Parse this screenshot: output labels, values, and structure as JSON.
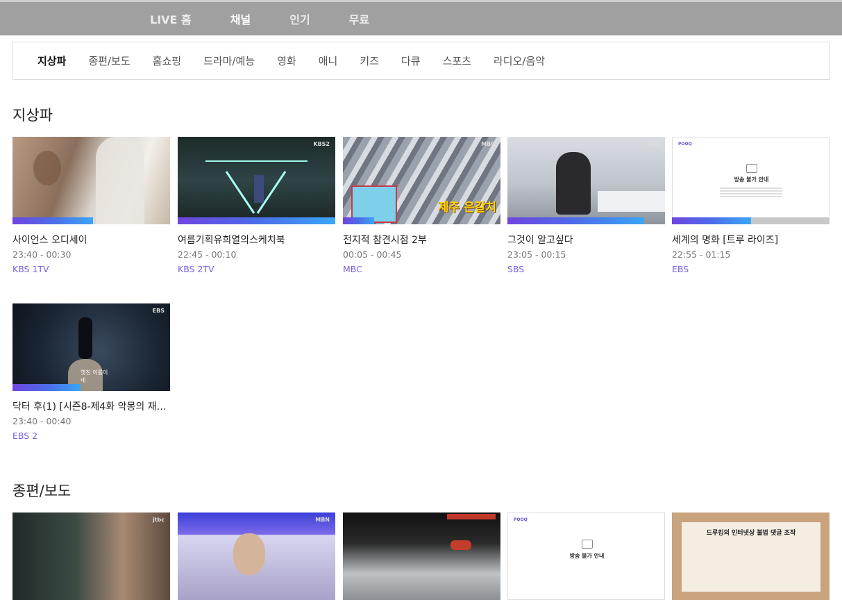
{
  "topnav": [
    {
      "label": "LIVE 홈",
      "active": false
    },
    {
      "label": "채널",
      "active": true
    },
    {
      "label": "인기",
      "active": false
    },
    {
      "label": "무료",
      "active": false
    }
  ],
  "categories": [
    {
      "label": "지상파",
      "active": true
    },
    {
      "label": "종편/보도",
      "active": false
    },
    {
      "label": "홈쇼핑",
      "active": false
    },
    {
      "label": "드라마/예능",
      "active": false
    },
    {
      "label": "영화",
      "active": false
    },
    {
      "label": "애니",
      "active": false
    },
    {
      "label": "키즈",
      "active": false
    },
    {
      "label": "다큐",
      "active": false
    },
    {
      "label": "스포츠",
      "active": false
    },
    {
      "label": "라디오/음악",
      "active": false
    }
  ],
  "sections": [
    {
      "title": "지상파",
      "cards": [
        {
          "title": "사이언스 오디세이",
          "time": "23:40 - 00:30",
          "channel": "KBS 1TV",
          "progress": 0.51,
          "badge": ""
        },
        {
          "title": "여름기획유희열의스케치북",
          "time": "22:45 - 00:10",
          "channel": "KBS 2TV",
          "progress": 1.0,
          "badge": "KBS2"
        },
        {
          "title": "전지적 참견시점 2부",
          "time": "00:05 - 00:45",
          "channel": "MBC",
          "progress": 0.2,
          "badge": "MBC",
          "caption": "제주 은갈치"
        },
        {
          "title": "그것이 알고싶다",
          "time": "23:05 - 00:15",
          "channel": "SBS",
          "progress": 0.87,
          "badge": "SBS"
        },
        {
          "title": "세계의 명화 [트루 라이즈]",
          "time": "22:55 - 01:15",
          "channel": "EBS",
          "progress": 0.5,
          "badge": "",
          "notice": "방송 불가 안내",
          "logo": "POOQ"
        },
        {
          "title": "닥터 후(1) [시즌8-제4화 악몽의 재…",
          "time": "23:40 - 00:40",
          "channel": "EBS 2",
          "progress": 0.43,
          "badge": "EBS",
          "caption": "옛친 이름이네"
        }
      ]
    },
    {
      "title": "종편/보도",
      "cards": [
        {
          "badge": "jtbc"
        },
        {
          "badge": "MBN"
        },
        {
          "badge": ""
        },
        {
          "notice": "방송 불가 안내",
          "logo": "POOQ"
        },
        {
          "caption": "드루킹의 인터넷상 불법 댓글 조작"
        }
      ]
    }
  ],
  "colors": {
    "topbar": "#a0a0a0",
    "accent": "#7a5ce0"
  }
}
